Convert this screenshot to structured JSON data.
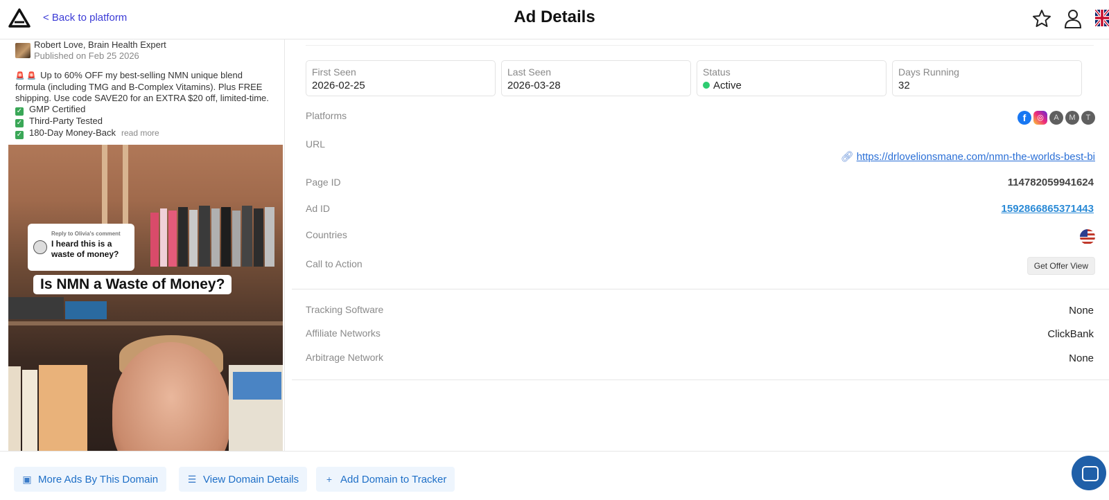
{
  "header": {
    "back_label": "< Back to platform",
    "title": "Ad Details"
  },
  "ad": {
    "author": "Robert Love, Brain Health Expert",
    "published": "Published on Feb 25 2026",
    "text_lines": [
      "Up to 60% OFF my best-selling NMN unique blend",
      "formula (including TMG and B-Complex Vitamins). Plus FREE",
      "shipping. Use code SAVE20 for an EXTRA $20 off, limited-time."
    ],
    "checks": [
      "GMP Certified",
      "Third-Party Tested",
      "180-Day Money-Back"
    ],
    "read_more": "read more",
    "media": {
      "comment_header": "Reply to Olivia's comment",
      "comment_text": "I heard this is a waste of money?",
      "caption": "Is NMN a Waste of Money?"
    }
  },
  "stats": [
    {
      "label": "First Seen",
      "value": "2026-02-25"
    },
    {
      "label": "Last Seen",
      "value": "2026-03-28"
    },
    {
      "label": "Status",
      "value": "Active"
    },
    {
      "label": "Days Running",
      "value": "32"
    }
  ],
  "details": {
    "platforms_label": "Platforms",
    "platforms": [
      "facebook",
      "instagram",
      "A",
      "M",
      "T"
    ],
    "url_label": "URL",
    "url": "https://drlovelionsmane.com/nmn-the-worlds-best-bi",
    "page_id_label": "Page ID",
    "page_id": "114782059941624",
    "ad_id_label": "Ad ID",
    "ad_id": "1592866865371443",
    "countries_label": "Countries",
    "cta_label": "Call to Action",
    "cta_value": "Get Offer View",
    "tracking_label": "Tracking Software",
    "tracking_value": "None",
    "affiliate_label": "Affiliate Networks",
    "affiliate_value": "ClickBank",
    "arbitrage_label": "Arbitrage Network",
    "arbitrage_value": "None"
  },
  "bottom": {
    "more_ads": "More Ads By This Domain",
    "view_domain": "View Domain Details",
    "add_domain": "Add Domain to Tracker"
  },
  "colors": {
    "accent": "#1e6fc7",
    "status_active": "#2ecc71",
    "link": "#2a6fd6"
  }
}
